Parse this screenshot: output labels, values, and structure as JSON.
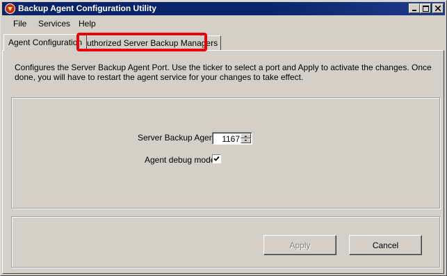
{
  "window": {
    "title": "Backup Agent Configuration Utility"
  },
  "menu": {
    "items": [
      "File",
      "Services",
      "Help"
    ]
  },
  "tabs": [
    {
      "label": "Agent Configuration",
      "active": true
    },
    {
      "label": "Authorized Server Backup Managers",
      "active": false,
      "highlighted": true
    }
  ],
  "main": {
    "description": "Configures the Server Backup Agent Port. Use the ticker to select a port and Apply to activate the changes. Once done, you will have to restart the agent service for your changes to take effect.",
    "port_label": "Server Backup Agent",
    "port_value": "1167",
    "debug_label": "Agent debug mode",
    "debug_checked": true
  },
  "buttons": {
    "apply": "Apply",
    "cancel": "Cancel"
  },
  "colors": {
    "title_bar": "#0a246a",
    "highlight": "#e8000b",
    "face": "#d4d0c8"
  }
}
